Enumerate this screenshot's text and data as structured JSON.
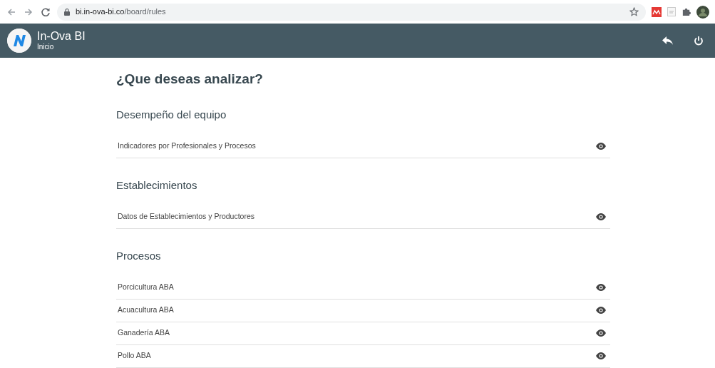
{
  "browser": {
    "url_host": "bi.in-ova-bi.co",
    "url_path": "/board/rules"
  },
  "app_bar": {
    "title": "In-Ova BI",
    "subtitle": "Inicio"
  },
  "page_title": "¿Que deseas analizar?",
  "sections": [
    {
      "heading": "Desempeño del equipo",
      "items": [
        {
          "label": "Indicadores por Profesionales y Procesos"
        }
      ]
    },
    {
      "heading": "Establecimientos",
      "items": [
        {
          "label": "Datos de Establecimientos y Productores"
        }
      ]
    },
    {
      "heading": "Procesos",
      "items": [
        {
          "label": "Porcicultura ABA"
        },
        {
          "label": "Acuacultura ABA"
        },
        {
          "label": "Ganadería ABA"
        },
        {
          "label": "Pollo ABA"
        }
      ]
    }
  ]
}
